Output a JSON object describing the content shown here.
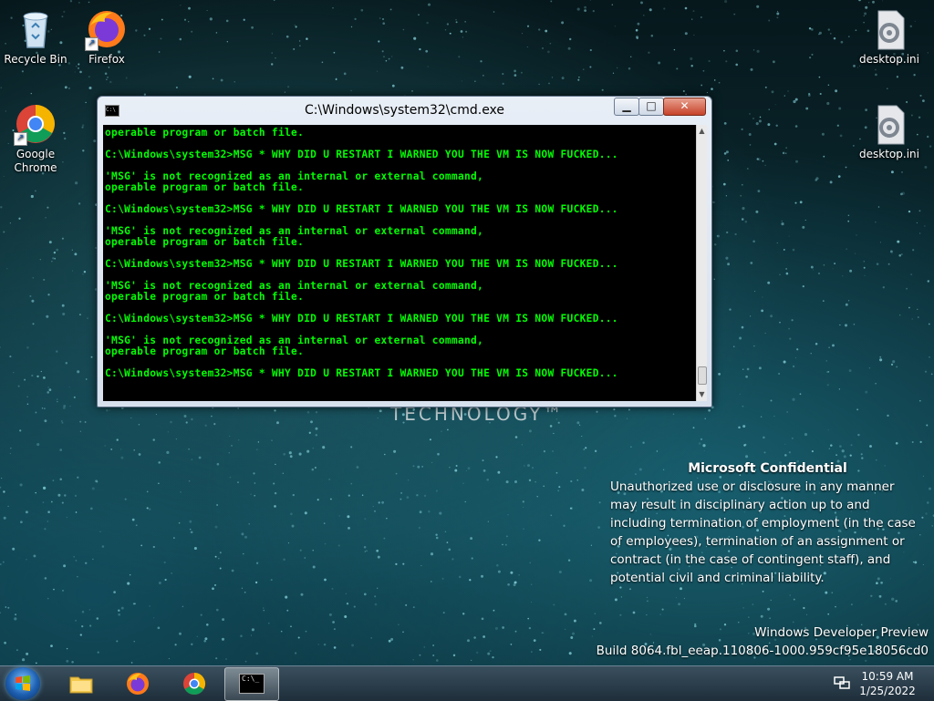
{
  "desktop": {
    "icons": [
      {
        "id": "recycle",
        "label": "Recycle Bin",
        "icon": "recycle-bin-icon"
      },
      {
        "id": "firefox",
        "label": "Firefox",
        "icon": "firefox-icon"
      },
      {
        "id": "chrome",
        "label": "Google Chrome",
        "icon": "chrome-icon"
      },
      {
        "id": "ini1",
        "label": "desktop.ini",
        "icon": "settings-file-icon"
      },
      {
        "id": "ini2",
        "label": "desktop.ini",
        "icon": "settings-file-icon"
      }
    ],
    "wallpaper_text": "TECHNOLOGY™"
  },
  "cmd_window": {
    "title": "C:\\Windows\\system32\\cmd.exe",
    "icon_text": "C:\\",
    "minimize_glyph": "▁",
    "maximize_glyph": "□",
    "close_glyph": "✕",
    "scroll_up_glyph": "▲",
    "scroll_down_glyph": "▼",
    "text_color": "#00ff00",
    "console_lines": [
      "operable program or batch file.",
      "",
      "C:\\Windows\\system32>MSG * WHY DID U RESTART I WARNED YOU THE VM IS NOW FUCKED...",
      "",
      "'MSG' is not recognized as an internal or external command,",
      "operable program or batch file.",
      "",
      "C:\\Windows\\system32>MSG * WHY DID U RESTART I WARNED YOU THE VM IS NOW FUCKED...",
      "",
      "'MSG' is not recognized as an internal or external command,",
      "operable program or batch file.",
      "",
      "C:\\Windows\\system32>MSG * WHY DID U RESTART I WARNED YOU THE VM IS NOW FUCKED...",
      "",
      "'MSG' is not recognized as an internal or external command,",
      "operable program or batch file.",
      "",
      "C:\\Windows\\system32>MSG * WHY DID U RESTART I WARNED YOU THE VM IS NOW FUCKED...",
      "",
      "'MSG' is not recognized as an internal or external command,",
      "operable program or batch file.",
      "",
      "C:\\Windows\\system32>MSG * WHY DID U RESTART I WARNED YOU THE VM IS NOW FUCKED..."
    ]
  },
  "watermark": {
    "heading": "Microsoft Confidential",
    "body": "Unauthorized use or disclosure in any manner may result in disciplinary action up to and including termination of employment (in the case of employees), termination of an assignment or contract (in the case of contingent staff), and potential civil and criminal liability.",
    "build_line1": "Windows Developer Preview",
    "build_line2": "Build 8064.fbl_eeap.110806-1000.959cf95e18056cd0"
  },
  "taskbar": {
    "items": [
      {
        "id": "start",
        "icon": "windows-start-icon"
      },
      {
        "id": "explorer",
        "icon": "folder-icon"
      },
      {
        "id": "firefox",
        "icon": "firefox-icon"
      },
      {
        "id": "chrome",
        "icon": "chrome-icon"
      },
      {
        "id": "cmd",
        "icon": "cmd-icon",
        "icon_text": "C:\\_",
        "active": true
      }
    ],
    "clock_time": "10:59 AM",
    "clock_date": "1/25/2022"
  }
}
